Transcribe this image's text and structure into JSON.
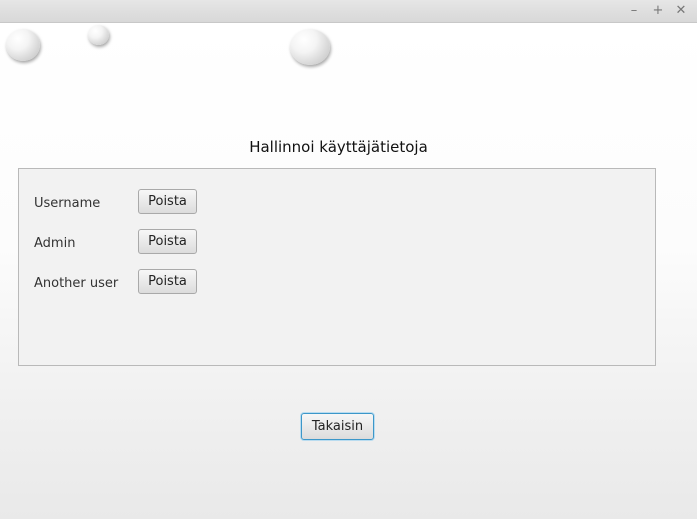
{
  "window": {
    "controls": {
      "minimize": "–",
      "maximize": "+",
      "close": "✕"
    }
  },
  "page": {
    "title": "Hallinnoi käyttäjätietoja"
  },
  "users": [
    {
      "name": "Username",
      "delete_label": "Poista"
    },
    {
      "name": "Admin",
      "delete_label": "Poista"
    },
    {
      "name": "Another user",
      "delete_label": "Poista"
    }
  ],
  "footer": {
    "back_label": "Takaisin"
  },
  "colors": {
    "focus_border": "#3c97c9",
    "panel_background": "#f2f2f2"
  }
}
